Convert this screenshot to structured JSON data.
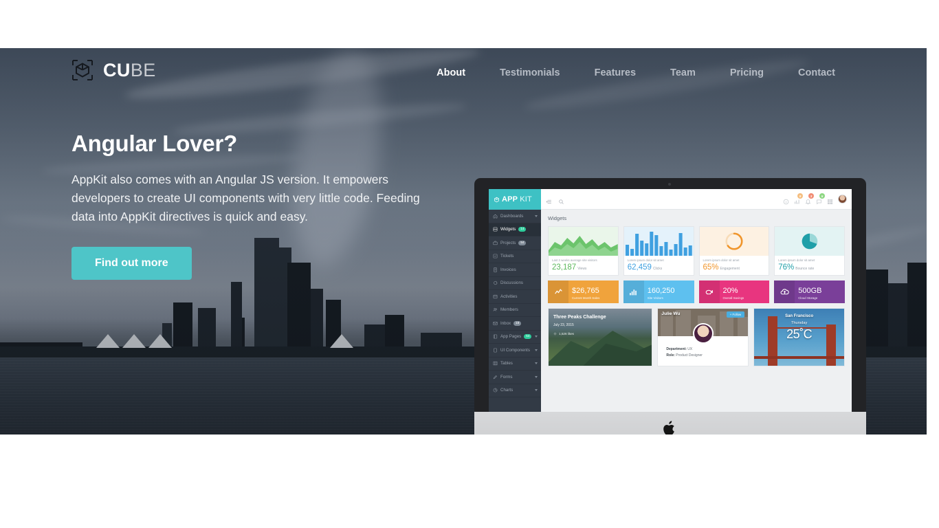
{
  "brand": {
    "text_bold": "CU",
    "text_light": "BE",
    "icon": "cube-icon"
  },
  "nav": {
    "items": [
      {
        "label": "About",
        "active": true
      },
      {
        "label": "Testimonials",
        "active": false
      },
      {
        "label": "Features",
        "active": false
      },
      {
        "label": "Team",
        "active": false
      },
      {
        "label": "Pricing",
        "active": false
      },
      {
        "label": "Contact",
        "active": false
      }
    ]
  },
  "hero": {
    "headline": "Angular Lover?",
    "body": "AppKit also comes with an Angular JS version. It empowers developers to create UI components with very little code. Feeding data into AppKit directives is quick and easy.",
    "cta_label": "Find out more",
    "accent_color": "#4ec5c8",
    "carousel": {
      "count": 3,
      "active_index": 1
    }
  },
  "app": {
    "logo": {
      "bold": "APP",
      "light": "KIT",
      "icon": "cube-icon"
    },
    "topbar": {
      "menu_icon": "hamburger-collapse-icon",
      "search_icon": "search-icon",
      "icons": [
        {
          "name": "info-icon",
          "badge": null,
          "badge_color": null
        },
        {
          "name": "chart-icon",
          "badge": "9",
          "badge_color": "#f0932b"
        },
        {
          "name": "bell-icon",
          "badge": "3",
          "badge_color": "#e84118"
        },
        {
          "name": "comment-icon",
          "badge": "5",
          "badge_color": "#44bd32"
        },
        {
          "name": "grid-apps-icon",
          "badge": null,
          "badge_color": null
        }
      ],
      "avatar": "user-avatar"
    },
    "sidebar": [
      {
        "label": "Dashboards",
        "icon": "home-icon",
        "badge": null,
        "badge_color": null,
        "caret": true,
        "active": false
      },
      {
        "label": "Widgets",
        "icon": "widgets-icon",
        "badge": "14",
        "badge_color": "#2ecc9b",
        "caret": false,
        "active": true
      },
      {
        "label": "Projects",
        "icon": "briefcase-icon",
        "badge": "54",
        "badge_color": "#7f8a96",
        "caret": false,
        "active": false
      },
      {
        "label": "Tickets",
        "icon": "ticket-icon",
        "badge": null,
        "badge_color": null,
        "caret": false,
        "active": false
      },
      {
        "label": "Invoices",
        "icon": "invoice-icon",
        "badge": null,
        "badge_color": null,
        "caret": false,
        "active": false
      },
      {
        "label": "Discussions",
        "icon": "chat-icon",
        "badge": null,
        "badge_color": null,
        "caret": false,
        "active": false
      },
      {
        "label": "Activities",
        "icon": "activity-icon",
        "badge": null,
        "badge_color": null,
        "caret": false,
        "active": false
      },
      {
        "label": "Members",
        "icon": "users-icon",
        "badge": null,
        "badge_color": null,
        "caret": false,
        "active": false
      },
      {
        "label": "Inbox",
        "icon": "envelope-icon",
        "badge": "18",
        "badge_color": "#7f8a96",
        "caret": false,
        "active": false
      },
      {
        "label": "App Pages",
        "icon": "pages-icon",
        "badge": "54",
        "badge_color": "#2ecc9b",
        "caret": true,
        "active": false
      },
      {
        "label": "UI Components",
        "icon": "components-icon",
        "badge": null,
        "badge_color": null,
        "caret": true,
        "active": false
      },
      {
        "label": "Tables",
        "icon": "table-icon",
        "badge": null,
        "badge_color": null,
        "caret": true,
        "active": false
      },
      {
        "label": "Forms",
        "icon": "forms-icon",
        "badge": null,
        "badge_color": null,
        "caret": true,
        "active": false
      },
      {
        "label": "Charts",
        "icon": "pie-chart-icon",
        "badge": null,
        "badge_color": null,
        "caret": true,
        "active": false
      }
    ],
    "panel_title": "Widgets",
    "stat_cards": [
      {
        "caption": "Last 2 weeks average site visitors",
        "value": "23,187",
        "unit": "Views",
        "color": "#5cb85c",
        "graph": "area-chart",
        "bg": "#eaf6ea"
      },
      {
        "caption": "Lorem ipsum dolor sit amet",
        "value": "62,459",
        "unit": "Clicks",
        "color": "#3fa0e0",
        "graph": "bar-chart",
        "bg": "#e4f2fb"
      },
      {
        "caption": "Lorem ipsum dolor sit amet",
        "value": "65%",
        "unit": "Engagement",
        "color": "#f0952b",
        "graph": "donut-chart",
        "bg": "#fdf1e2"
      },
      {
        "caption": "Lorem ipsum dolor sit amet",
        "value": "76%",
        "unit": "Bounce rate",
        "color": "#1f9fa8",
        "graph": "pie-chart",
        "bg": "#e3f3f3"
      }
    ],
    "tile_cards": [
      {
        "value": "$26,765",
        "label": "Current Month Sales",
        "icon": "line-chart-icon",
        "color": "#f0a33c",
        "icon_bg": "#e08b22"
      },
      {
        "value": "160,250",
        "label": "Site Visitors",
        "icon": "bar-chart-icon",
        "color": "#5ec0ef",
        "icon_bg": "#3aa8e0"
      },
      {
        "value": "20%",
        "label": "Overall Savings",
        "icon": "piggy-bank-icon",
        "color": "#e8357f",
        "icon_bg": "#d41f6b"
      },
      {
        "value": "500GB",
        "label": "Cloud Storage",
        "icon": "cloud-upload-icon",
        "color": "#7a3f99",
        "icon_bg": "#67327f"
      }
    ],
    "peaks_card": {
      "title": "Three Peaks Challenge",
      "date": "July 23, 2015",
      "likes": "1,526 likes",
      "like_icon": "heart-icon"
    },
    "profile_card": {
      "name": "Julie Wu",
      "follow_label": "+ Follow",
      "department_label": "Department:",
      "department_value": "UX",
      "role_label": "Role:",
      "role_value": "Product Designer"
    },
    "weather_card": {
      "city": "San Francisco",
      "day": "Thursday",
      "temperature": "25˚C"
    }
  }
}
